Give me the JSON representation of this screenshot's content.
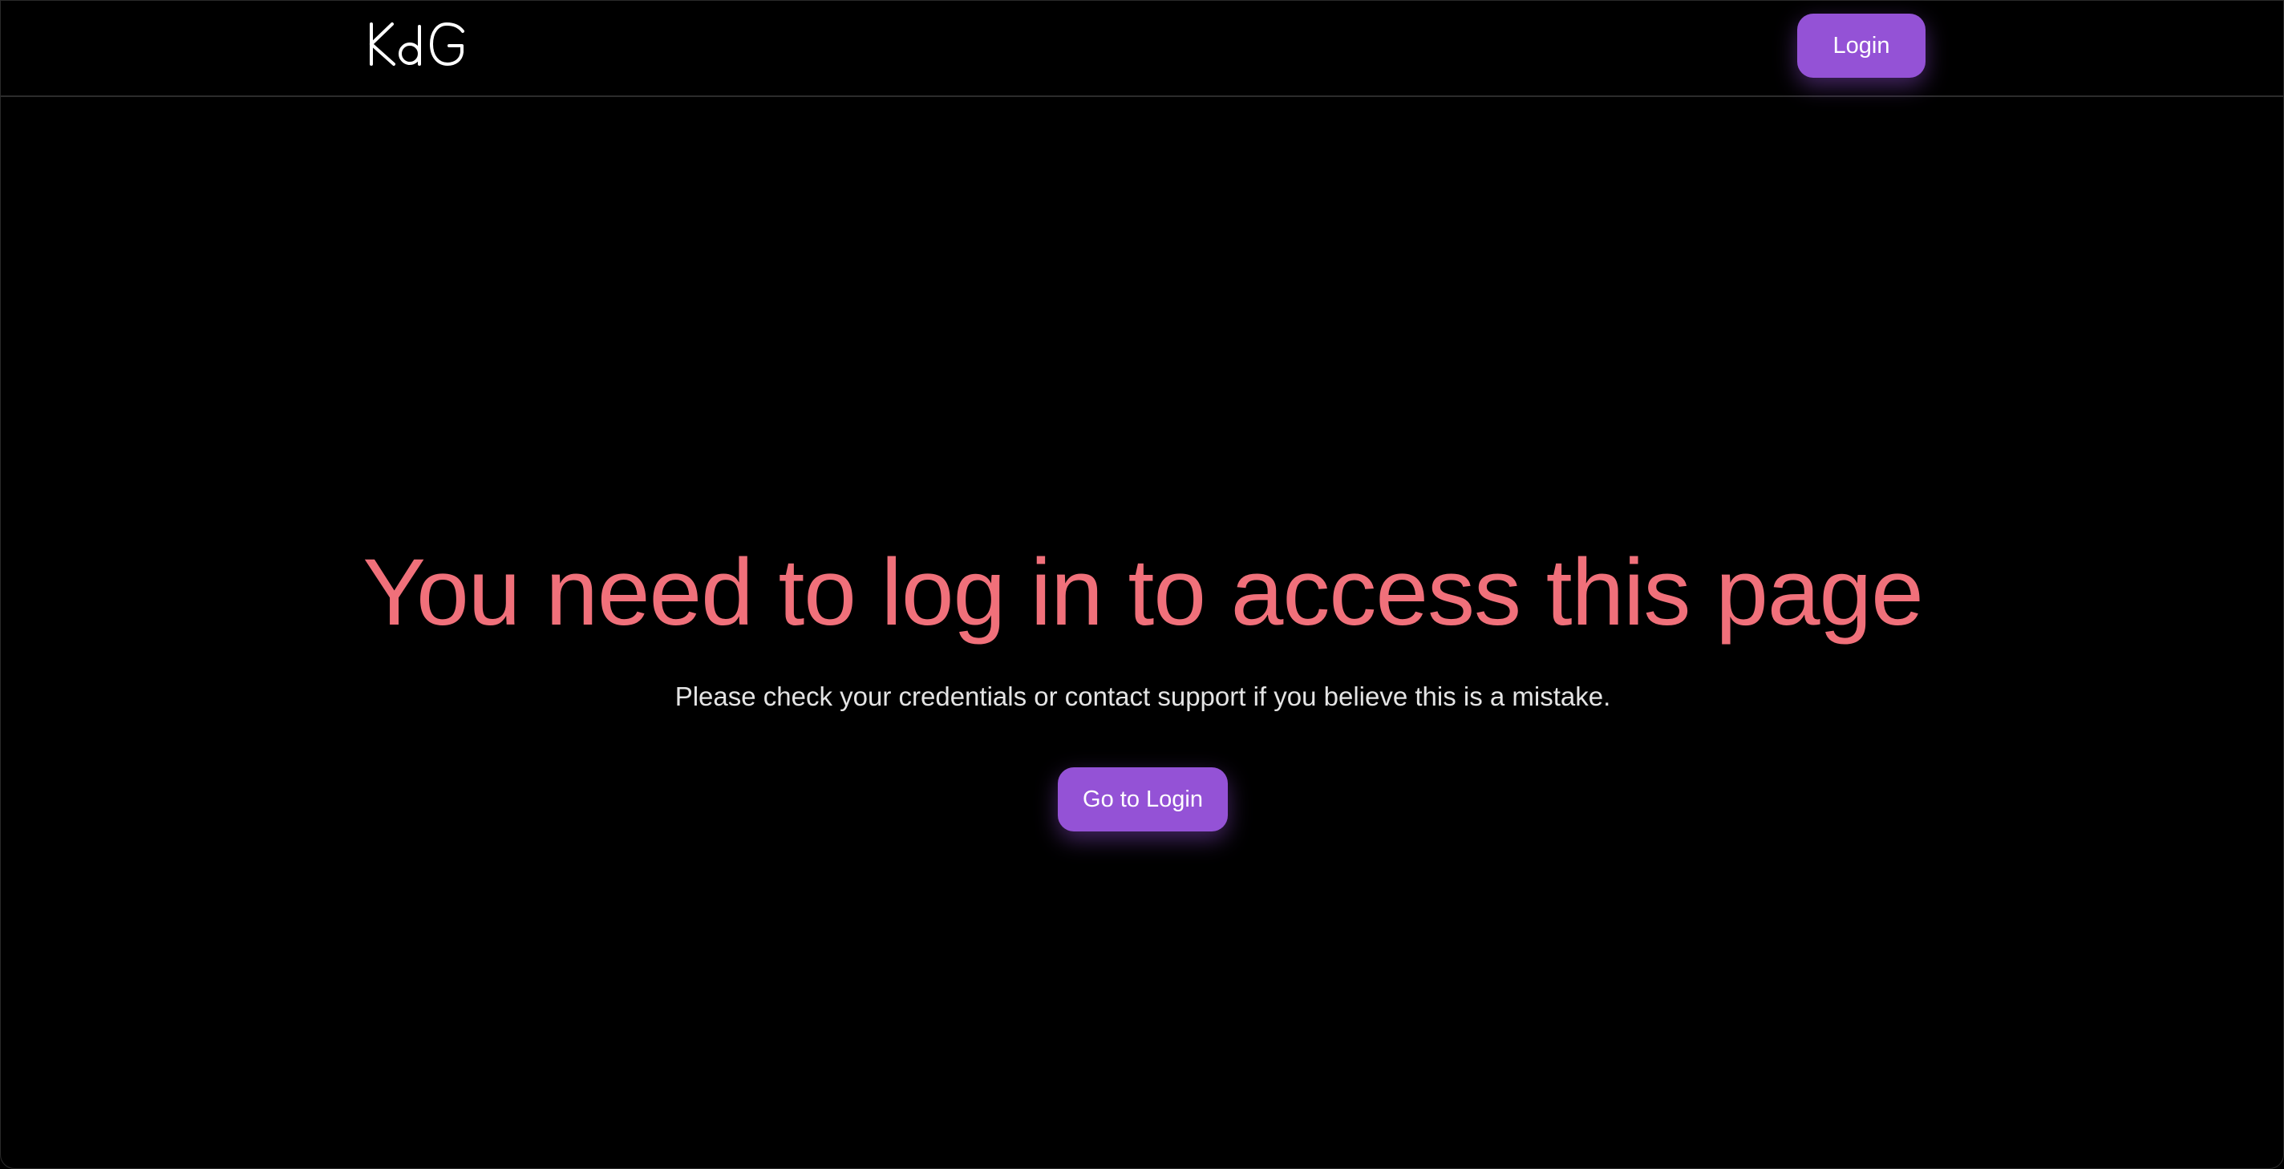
{
  "navbar": {
    "logo_text": "KdG",
    "login_label": "Login"
  },
  "main": {
    "title": "You need to log in to access this page",
    "subtitle": "Please check your credentials or contact support if you believe this is a mistake.",
    "cta_label": "Go to Login"
  },
  "colors": {
    "background": "#000000",
    "accent": "#9452d6",
    "title": "#f0707a",
    "subtitle": "#e4e4e4"
  }
}
